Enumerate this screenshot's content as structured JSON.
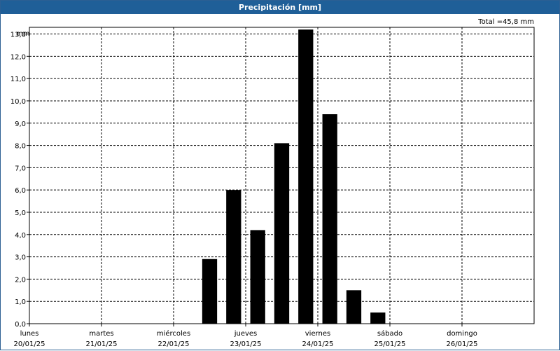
{
  "window": {
    "title": "Precipitación [mm]"
  },
  "total_label": "Total =45,8 mm",
  "chart_data": {
    "type": "bar",
    "title": "Precipitación [mm]",
    "ylabel": "mm",
    "ylim": [
      0,
      13.3
    ],
    "yticks": [
      "0,0",
      "1,0",
      "2,0",
      "3,0",
      "4,0",
      "5,0",
      "6,0",
      "7,0",
      "8,0",
      "9,0",
      "10,0",
      "11,0",
      "12,0",
      "13,0"
    ],
    "xlim": [
      0,
      7
    ],
    "days": [
      {
        "name": "lunes",
        "date": "20/01/25"
      },
      {
        "name": "martes",
        "date": "21/01/25"
      },
      {
        "name": "miércoles",
        "date": "22/01/25"
      },
      {
        "name": "jueves",
        "date": "23/01/25"
      },
      {
        "name": "viernes",
        "date": "24/01/25"
      },
      {
        "name": "sábado",
        "date": "25/01/25"
      },
      {
        "name": "domingo",
        "date": "26/01/25"
      }
    ],
    "bars": [
      {
        "x": 2.5,
        "value": 2.9
      },
      {
        "x": 2.833,
        "value": 6.0
      },
      {
        "x": 3.167,
        "value": 4.2
      },
      {
        "x": 3.5,
        "value": 8.1
      },
      {
        "x": 3.833,
        "value": 13.2
      },
      {
        "x": 4.167,
        "value": 9.4
      },
      {
        "x": 4.5,
        "value": 1.5
      },
      {
        "x": 4.833,
        "value": 0.5
      }
    ],
    "grid": true,
    "bar_color": "#000000"
  }
}
